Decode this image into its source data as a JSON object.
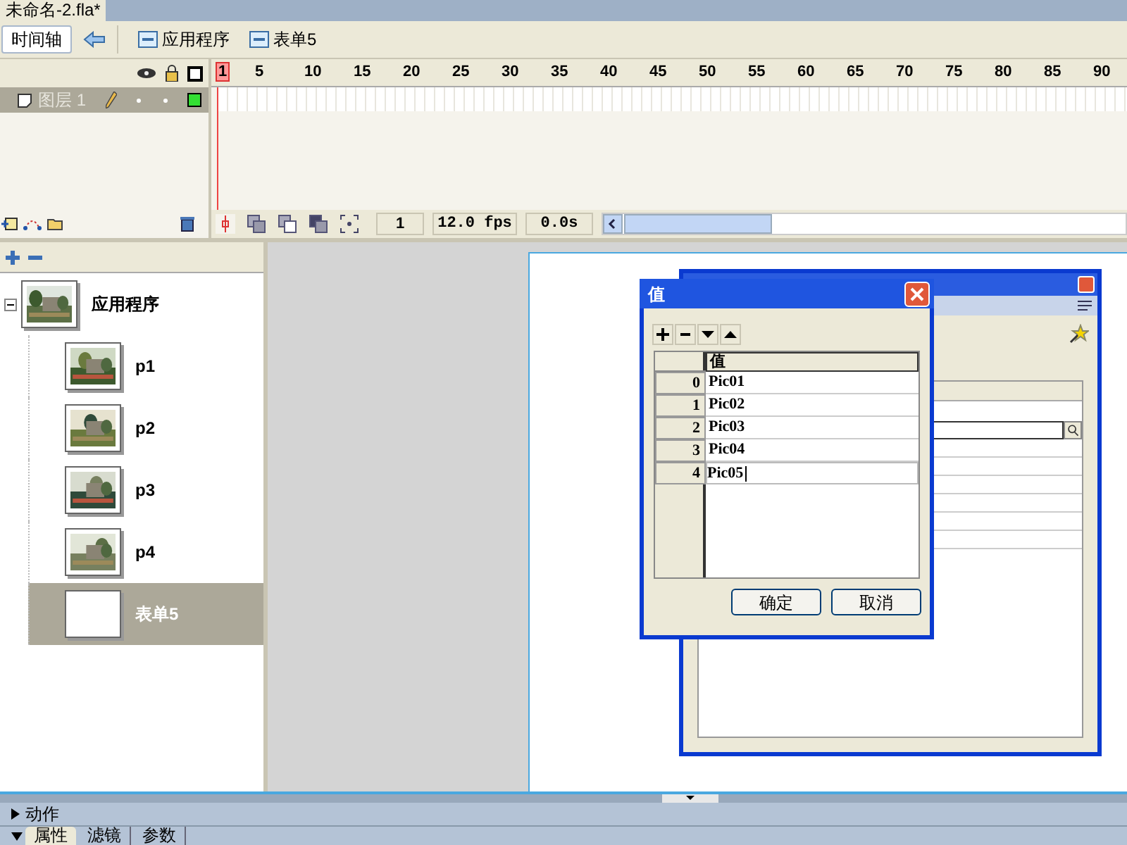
{
  "document_tab": {
    "title": "未命名-2.fla*",
    "selected": true
  },
  "toolbar": {
    "timeline_button": "时间轴",
    "breadcrumbs": [
      "应用程序",
      "表单5"
    ]
  },
  "timeline": {
    "layers": [
      {
        "name": "图层 1",
        "selected": true
      }
    ],
    "ruler": [
      "1",
      "5",
      "10",
      "15",
      "20",
      "25",
      "30",
      "35",
      "40",
      "45",
      "50",
      "55",
      "60",
      "65",
      "70",
      "75",
      "80",
      "85",
      "90"
    ],
    "current_frame": "1",
    "frame_rate": "12.0 fps",
    "elapsed": "0.0s"
  },
  "tree": {
    "root": {
      "label": "应用程序",
      "kind": "picture",
      "expanded": true,
      "selected": false,
      "children": [
        {
          "label": "p1",
          "kind": "picture",
          "selected": false
        },
        {
          "label": "p2",
          "kind": "picture",
          "selected": false
        },
        {
          "label": "p3",
          "kind": "picture",
          "selected": false
        },
        {
          "label": "p4",
          "kind": "picture",
          "selected": false
        },
        {
          "label": "表单5",
          "kind": "blank",
          "selected": true
        }
      ]
    }
  },
  "dialog": {
    "title": "值",
    "column": "值",
    "rows": [
      {
        "index": "0",
        "value": "Pic01",
        "editing": false
      },
      {
        "index": "1",
        "value": "Pic02",
        "editing": false
      },
      {
        "index": "2",
        "value": "Pic03",
        "editing": false
      },
      {
        "index": "3",
        "value": "Pic04",
        "editing": false
      },
      {
        "index": "4",
        "value": "Pic05",
        "editing": true
      }
    ],
    "buttons": [
      "确定",
      "取消"
    ]
  },
  "panels": {
    "actions": {
      "label": "动作",
      "expanded": false
    },
    "properties": {
      "expanded": true,
      "tabs": [
        {
          "label": "属性",
          "selected": true
        },
        {
          "label": "滤镜",
          "selected": false
        },
        {
          "label": "参数",
          "selected": false
        }
      ]
    }
  }
}
